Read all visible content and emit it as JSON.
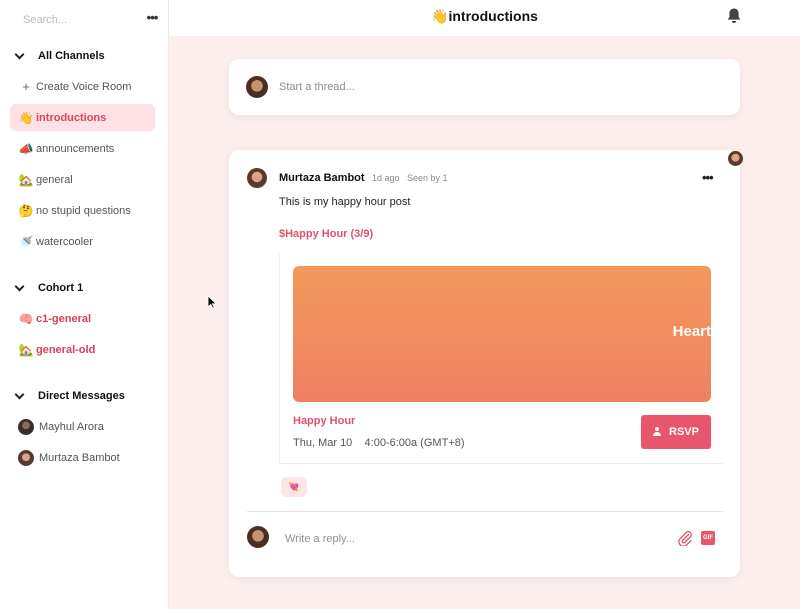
{
  "search": {
    "placeholder": "Search..."
  },
  "sidebar": {
    "more_label": "•••",
    "sections": [
      {
        "title": "All Channels"
      },
      {
        "title": "Cohort 1"
      },
      {
        "title": "Direct Messages"
      }
    ],
    "create_voice_room": {
      "icon": "+",
      "label": "Create Voice Room"
    },
    "channels": [
      {
        "emoji": "👋",
        "label": "introductions",
        "state": "active"
      },
      {
        "emoji": "📣",
        "label": "announcements",
        "state": "normal"
      },
      {
        "emoji": "🏡",
        "label": "general",
        "state": "normal"
      },
      {
        "emoji": "🤔",
        "label": "no stupid questions",
        "state": "normal"
      },
      {
        "emoji": "🚿",
        "label": "watercooler",
        "state": "normal"
      }
    ],
    "cohort_channels": [
      {
        "emoji": "🧠",
        "label": "c1-general",
        "state": "unread"
      },
      {
        "emoji": "🏡",
        "label": "general-old",
        "state": "unread"
      }
    ],
    "direct_messages": [
      {
        "label": "Mayhul Arora"
      },
      {
        "label": "Murtaza Bambot"
      }
    ]
  },
  "header": {
    "title": "👋introductions"
  },
  "composer": {
    "placeholder": "Start a thread..."
  },
  "post": {
    "author": "Murtaza Bambot",
    "meta": "1d ago   Seen by 1",
    "more_label": "•••",
    "text": "This is my happy hour post",
    "event_link": "$Happy Hour (3/9)",
    "event": {
      "banner_text": "Heart",
      "name": "Happy Hour",
      "time": "Thu, Mar 10    4:00-6:00a (GMT+8)",
      "rsvp_label": "RSVP"
    },
    "reaction": "💘",
    "reply_placeholder": "Write a reply...",
    "gif_label": "GIF"
  },
  "colors": {
    "accent": "#e0506a",
    "main_background": "#fbeeed",
    "active_channel_bg": "#fde1e4",
    "banner_top": "#f39a5b",
    "banner_bottom": "#f07f63"
  }
}
